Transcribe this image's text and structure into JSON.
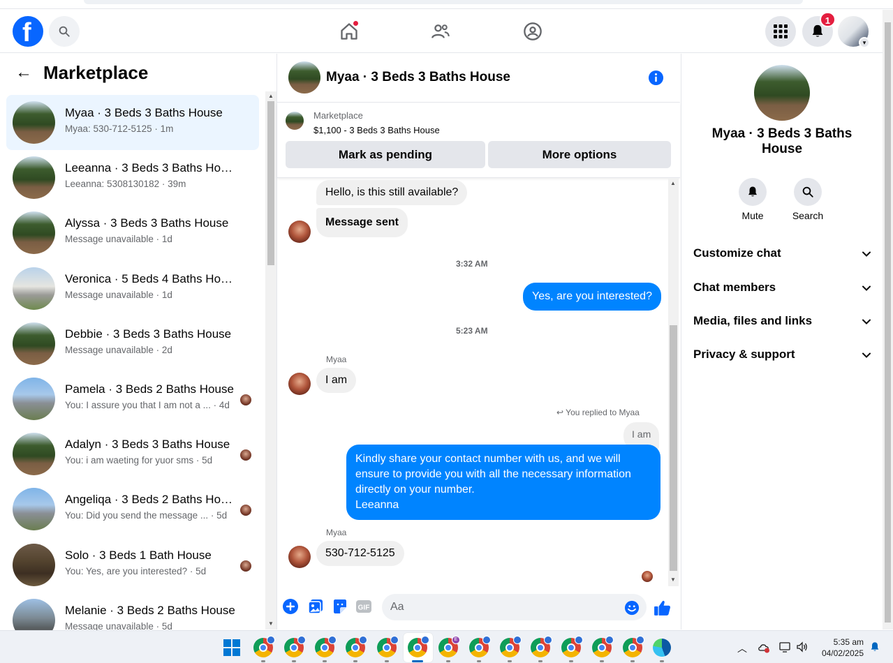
{
  "marketplace": {
    "title": "Marketplace",
    "conversations": [
      {
        "name": "Myaa · 3 Beds 3 Baths House",
        "snippet": "Myaa: 530-712-5125 · 1m",
        "active": true,
        "photo": "house-green",
        "seen": false
      },
      {
        "name": "Leeanna · 3 Beds 3 Baths House",
        "snippet": "Leeanna: 5308130182 · 39m",
        "active": false,
        "photo": "house-green",
        "seen": false
      },
      {
        "name": "Alyssa · 3 Beds 3 Baths House",
        "snippet": "Message unavailable · 1d",
        "active": false,
        "photo": "house-green",
        "seen": false
      },
      {
        "name": "Veronica · 5 Beds 4 Baths House",
        "snippet": "Message unavailable · 1d",
        "active": false,
        "photo": "house-white",
        "seen": false
      },
      {
        "name": "Debbie · 3 Beds 3 Baths House",
        "snippet": "Message unavailable · 2d",
        "active": false,
        "photo": "house-green",
        "seen": false
      },
      {
        "name": "Pamela · 3 Beds 2 Baths House",
        "snippet": "You: I assure you that I am not a ... · 4d",
        "active": false,
        "photo": "house-blue",
        "seen": true
      },
      {
        "name": "Adalyn · 3 Beds 3 Baths House",
        "snippet": "You: i am waeting for yuor sms · 5d",
        "active": false,
        "photo": "house-green",
        "seen": true
      },
      {
        "name": "Angeliqa · 3 Beds 2 Baths Hou...",
        "snippet": "You: Did you send the message ... · 5d",
        "active": false,
        "photo": "house-blue",
        "seen": true
      },
      {
        "name": "Solo · 3 Beds 1 Bath House",
        "snippet": "You: Yes, are you interested? · 5d",
        "active": false,
        "photo": "house-dark",
        "seen": true
      },
      {
        "name": "Melanie · 3 Beds 2 Baths House",
        "snippet": "Message unavailable · 5d",
        "active": false,
        "photo": "house-street",
        "seen": false
      }
    ]
  },
  "nav": {
    "notifications_count": "1"
  },
  "chat": {
    "title": "Myaa · 3 Beds 3 Baths House",
    "marketplace_label": "Marketplace",
    "listing": "$1,100 - 3 Beds 3 Baths House",
    "mark_pending": "Mark as pending",
    "more_options": "More options",
    "messages": {
      "m1": "Hello, is this still available?",
      "m2": "Message sent",
      "t1": "3:32 AM",
      "m3": "Yes, are you interested?",
      "t2": "5:23 AM",
      "sender1": "Myaa",
      "m4": "I am",
      "reply_note": "You replied to Myaa",
      "quoted": "I am",
      "m5": "Kindly share your contact number with us, and we will ensure to provide you with all the necessary information directly on your number.\nLeeanna",
      "sender2": "Myaa",
      "m6": "530-712-5125"
    },
    "composer_placeholder": "Aa"
  },
  "details": {
    "name": "Myaa · 3 Beds 3 Baths House",
    "mute": "Mute",
    "search": "Search",
    "sections": [
      "Customize chat",
      "Chat members",
      "Media, files and links",
      "Privacy & support"
    ]
  },
  "taskbar": {
    "time": "5:35 am",
    "date": "04/02/2025",
    "profile_letter": "E"
  }
}
